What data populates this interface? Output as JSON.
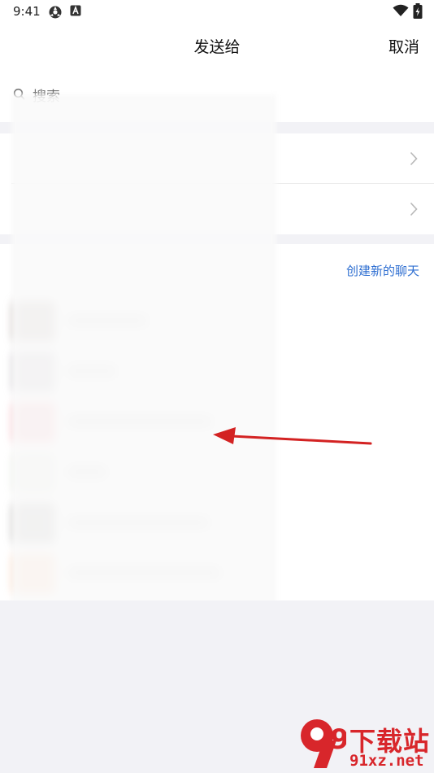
{
  "status_bar": {
    "time": "9:41"
  },
  "nav": {
    "title": "发送给",
    "cancel": "取消"
  },
  "search": {
    "placeholder": "搜索"
  },
  "section": {
    "create_new_chat": "创建新的聊天"
  },
  "contacts": [
    {
      "avatar_color": "#9a8a82"
    },
    {
      "avatar_color": "#a49ba6"
    },
    {
      "avatar_color": "#f08a95"
    },
    {
      "avatar_color": "#d8dccf"
    },
    {
      "avatar_color": "#8d8a86"
    },
    {
      "avatar_color": "#f7b98d"
    }
  ],
  "colors": {
    "accent_link": "#2f6fd1",
    "annotation_arrow": "#d32222",
    "watermark": "#d8262b",
    "section_gap": "#f2f2f6"
  },
  "watermark": {
    "brand": "下载站",
    "url": "91xz.net",
    "logo_digit": "9"
  }
}
